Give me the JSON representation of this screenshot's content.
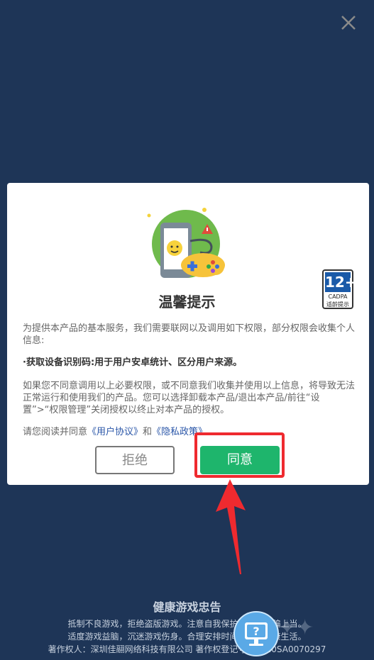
{
  "dialog": {
    "title": "温馨提示",
    "intro": "为提供本产品的基本服务，我们需要联网以及调用如下权限，部分权限会收集个人信息:",
    "permission": "·获取设备识别码:用于用户安卓统计、区分用户来源。",
    "disagree_text": "如果您不同意调用以上必要权限，或不同意我们收集并使用以上信息，将导致无法正常运行和使用我们的产品。您可以选择卸载本产品/退出本产品/前往“设置”>“权限管理”关闭授权以终止对本产品的授权。",
    "agreement_prefix": "请您阅读并同意",
    "user_agreement": "《用户协议》",
    "and": "和",
    "privacy_policy": "《隐私政策》",
    "reject_label": "拒绝",
    "agree_label": "同意"
  },
  "age_badge": {
    "rating": "12+",
    "org": "CADPA",
    "hint": "适龄提示"
  },
  "footer": {
    "heading": "健康游戏忠告",
    "lines": [
      "抵制不良游戏，拒绝盗版游戏。注意自我保护，谨防受骗上当。",
      "适度游戏益脑，沉迷游戏伤身。合理安排时间，享受健康生活。",
      "著作权人：深圳佳翮网络科技有限公司   著作权登记号：2020SA0070297"
    ]
  },
  "colors": {
    "background": "#1e3557",
    "agree_button": "#1eb56c",
    "highlight": "#ef2a2f",
    "link": "#2a56a8"
  },
  "icons": [
    "close-icon",
    "game-illustration-icon",
    "age-rating-badge",
    "help-icon",
    "annotation-arrow"
  ]
}
